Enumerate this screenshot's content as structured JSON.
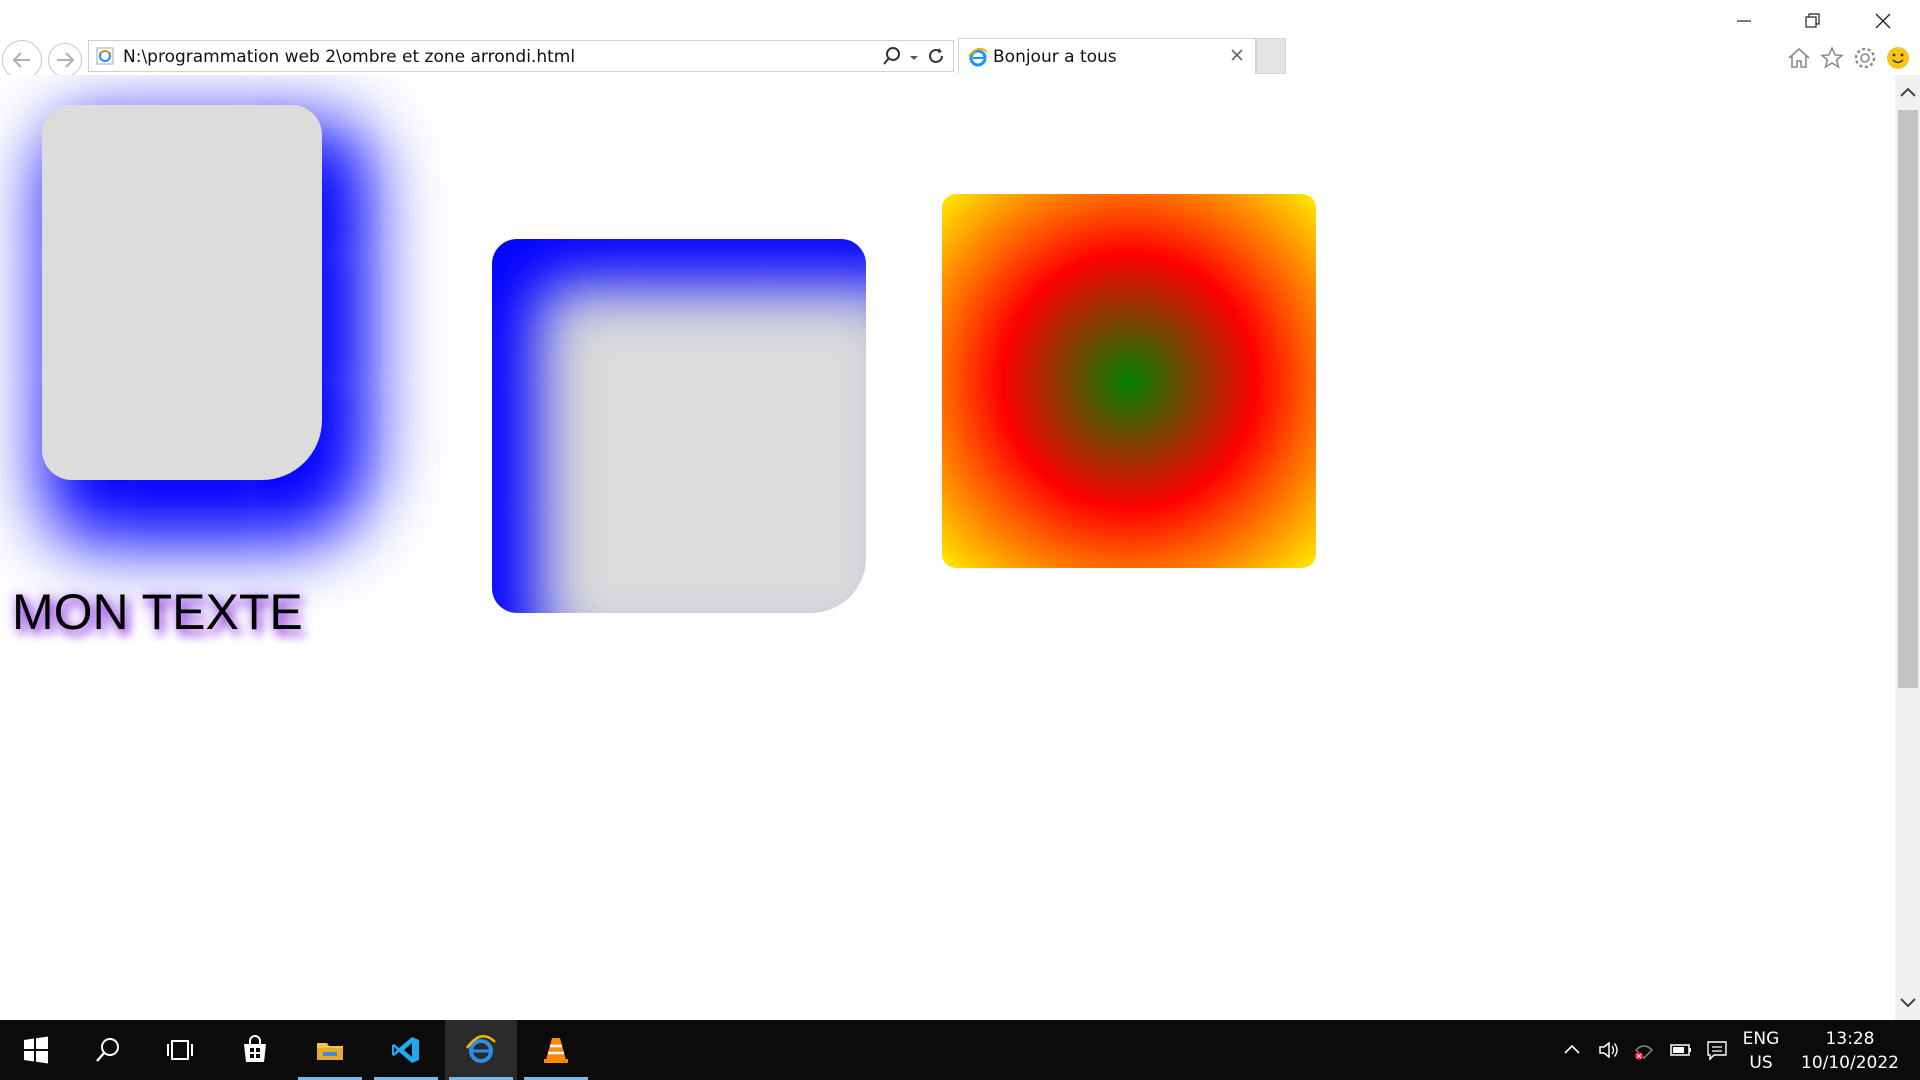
{
  "browser": {
    "address_url": "N:\\programmation web 2\\ombre et zone arrondi.html",
    "tab_title": "Bonjour a tous"
  },
  "page": {
    "shadow_text": "MON TEXTE",
    "colors": {
      "outer_shadow": "#0000ff",
      "inset_shadow": "#0000ff",
      "box_fill": "#dcdcdc",
      "gradient_center": "#008000",
      "gradient_mid": "#ff0000",
      "gradient_edge": "#ffee00",
      "text_shadow": "#8a2be2"
    }
  },
  "taskbar": {
    "apps": [
      "start-icon",
      "search-icon",
      "task-view-icon",
      "store-icon",
      "file-explorer-icon",
      "vscode-icon",
      "internet-explorer-icon",
      "vlc-icon"
    ],
    "language": "ENG",
    "region": "US",
    "time": "13:28",
    "date": "10/10/2022"
  }
}
